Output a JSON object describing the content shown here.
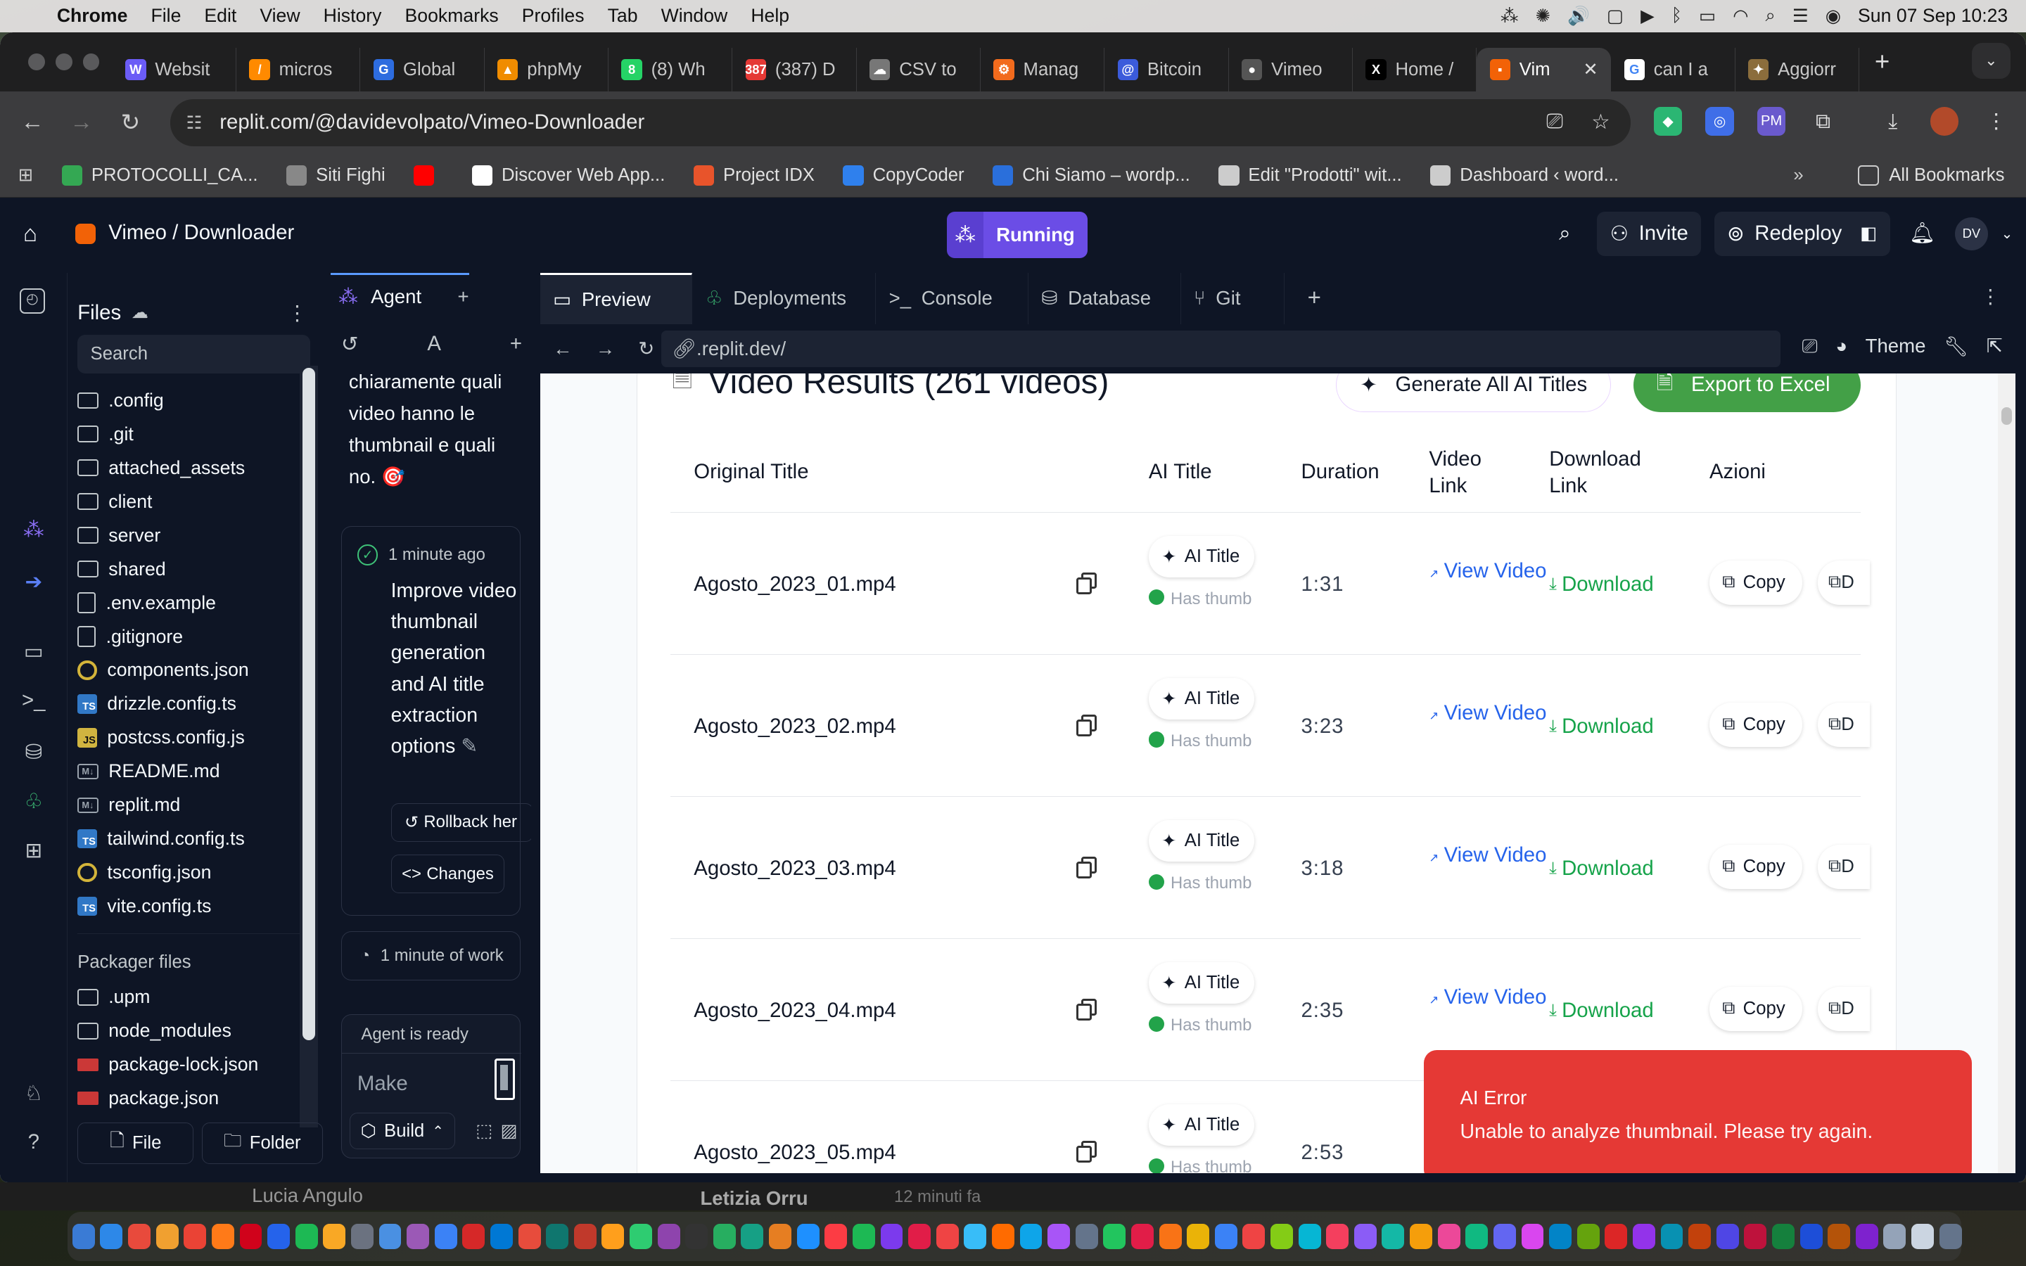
{
  "menubar": {
    "app": "Chrome",
    "items": [
      "File",
      "Edit",
      "View",
      "History",
      "Bookmarks",
      "Profiles",
      "Tab",
      "Window",
      "Help"
    ],
    "datetime": "Sun 07 Sep  10:23"
  },
  "tabs": [
    {
      "label": "Websit",
      "color": "#6b5cf6",
      "glyph": "W"
    },
    {
      "label": "micros",
      "color": "#ff8a00",
      "glyph": "/"
    },
    {
      "label": "Global",
      "color": "#2d6cdf",
      "glyph": "G"
    },
    {
      "label": "phpMy",
      "color": "#f08c00",
      "glyph": "▲"
    },
    {
      "label": "(8) Wh",
      "color": "#25d366",
      "glyph": "8"
    },
    {
      "label": "(387) D",
      "color": "#e53935",
      "glyph": "387"
    },
    {
      "label": "CSV to",
      "color": "#777777",
      "glyph": "☁"
    },
    {
      "label": "Manag",
      "color": "#f26b1d",
      "glyph": "⚙"
    },
    {
      "label": "Bitcoin",
      "color": "#3b5bdb",
      "glyph": "@"
    },
    {
      "label": "Vimeo",
      "color": "#555555",
      "glyph": "●"
    },
    {
      "label": "Home /",
      "color": "#000000",
      "glyph": "X"
    },
    {
      "label": "Vim",
      "color": "#f26207",
      "glyph": "▪",
      "active": true
    },
    {
      "label": "can I a",
      "color": "#ffffff",
      "glyph": "G"
    },
    {
      "label": "Aggiorr",
      "color": "#8b6d3c",
      "glyph": "✦"
    }
  ],
  "address": {
    "url": "replit.com/@davidevolpato/Vimeo-Downloader"
  },
  "bookmarks": [
    {
      "label": "PROTOCOLLI_CA...",
      "color": "#34a853"
    },
    {
      "label": "Siti Fighi",
      "color": "#888888"
    },
    {
      "label": "",
      "color": "#ff0000"
    },
    {
      "label": "Discover Web App...",
      "color": "#ffffff"
    },
    {
      "label": "Project IDX",
      "color": "#e8542b"
    },
    {
      "label": "CopyCoder",
      "color": "#2f80ed"
    },
    {
      "label": "Chi Siamo – wordp...",
      "color": "#2a6fdb"
    },
    {
      "label": "Edit \"Prodotti\" wit...",
      "color": "#cccccc"
    },
    {
      "label": "Dashboard ‹ word...",
      "color": "#cccccc"
    }
  ],
  "all_bookmarks": "All Bookmarks",
  "replit": {
    "project": "Vimeo / Downloader",
    "status": "Running",
    "invite": "Invite",
    "redeploy": "Redeploy",
    "avatar": "DV"
  },
  "files": {
    "title": "Files",
    "search_placeholder": "Search",
    "items": [
      {
        "name": ".config",
        "kind": "folder"
      },
      {
        "name": ".git",
        "kind": "folder"
      },
      {
        "name": "attached_assets",
        "kind": "folder"
      },
      {
        "name": "client",
        "kind": "folder"
      },
      {
        "name": "server",
        "kind": "folder"
      },
      {
        "name": "shared",
        "kind": "folder"
      },
      {
        "name": ".env.example",
        "kind": "file"
      },
      {
        "name": ".gitignore",
        "kind": "file"
      },
      {
        "name": "components.json",
        "kind": "json"
      },
      {
        "name": "drizzle.config.ts",
        "kind": "ts"
      },
      {
        "name": "postcss.config.js",
        "kind": "js"
      },
      {
        "name": "README.md",
        "kind": "md"
      },
      {
        "name": "replit.md",
        "kind": "md"
      },
      {
        "name": "tailwind.config.ts",
        "kind": "ts"
      },
      {
        "name": "tsconfig.json",
        "kind": "json"
      },
      {
        "name": "vite.config.ts",
        "kind": "ts"
      }
    ],
    "packager_title": "Packager files",
    "packager": [
      {
        "name": ".upm",
        "kind": "folder"
      },
      {
        "name": "node_modules",
        "kind": "folder"
      },
      {
        "name": "package-lock.json",
        "kind": "npm"
      },
      {
        "name": "package.json",
        "kind": "npm"
      }
    ],
    "new_file": "File",
    "new_folder": "Folder"
  },
  "agent": {
    "tab": "Agent",
    "tool_label": "A",
    "message": "chiaramente quali video hanno le thumbnail e quali no. 🎯",
    "card_time": "1 minute ago",
    "card_text": "Improve video thumbnail generation and AI title extraction options",
    "rollback": "Rollback her",
    "changes": "Changes",
    "work": "1 minute of work",
    "ready": "Agent is ready",
    "input_placeholder": "Make",
    "build": "Build"
  },
  "pane_tabs": [
    "Preview",
    "Deployments",
    "Console",
    "Database",
    "Git"
  ],
  "preview": {
    "url": ".replit.dev/",
    "theme": "Theme"
  },
  "results": {
    "title": "Video Results (261 videos)",
    "generate_all": "Generate All AI Titles",
    "export": "Export to Excel",
    "headers": {
      "original": "Original Title",
      "ai": "AI Title",
      "duration": "Duration",
      "video": "Video Link",
      "download": "Download Link",
      "actions": "Azioni"
    },
    "ai_btn": "AI Title",
    "has_thumb": "Has thumb",
    "view_video": "View Video",
    "download": "Download",
    "copy": "Copy",
    "copy2_partial": "D",
    "rows": [
      {
        "title": "Agosto_2023_01.mp4",
        "duration": "1:31"
      },
      {
        "title": "Agosto_2023_02.mp4",
        "duration": "3:23"
      },
      {
        "title": "Agosto_2023_03.mp4",
        "duration": "3:18"
      },
      {
        "title": "Agosto_2023_04.mp4",
        "duration": "2:35"
      },
      {
        "title": "Agosto_2023_05.mp4",
        "duration": "2:53"
      }
    ]
  },
  "toast": {
    "title": "AI Error",
    "message": "Unable to analyze thumbnail. Please try again."
  },
  "background_strip": {
    "left": "Lucia Angulo",
    "right": "Letizia Orru",
    "time": "12 minuti fa"
  }
}
